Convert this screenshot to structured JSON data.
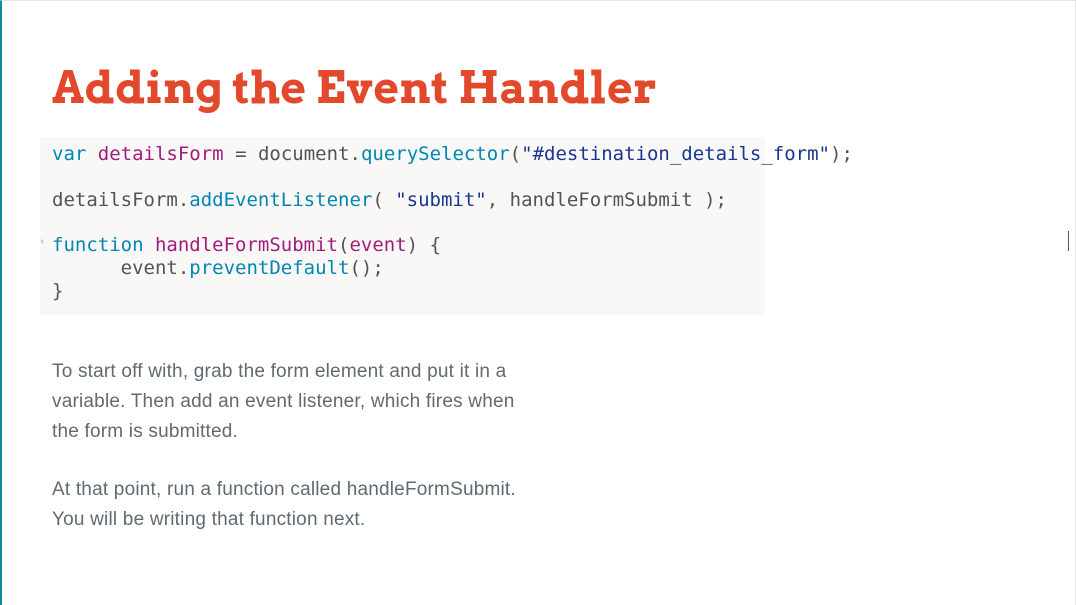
{
  "title": "Adding the Event Handler",
  "code": {
    "l1": {
      "kw": "var",
      "sp1": " ",
      "id": "detailsForm",
      "sp2": " ",
      "eq": "=",
      "sp3": " ",
      "doc": "document",
      "dot1": ".",
      "m1": "querySelector",
      "op": "(",
      "str": "\"#destination_details_form\"",
      "cp": ")",
      "semi": ";"
    },
    "l2_blank": "",
    "l3": {
      "id": "detailsForm",
      "dot": ".",
      "m": "addEventListener",
      "op": "( ",
      "str": "\"submit\"",
      "comma": ", ",
      "fn": "handleFormSubmit",
      "cp": " )",
      "semi": ";"
    },
    "l4_blank": "",
    "l5": {
      "kw": "function",
      "sp": " ",
      "fn": "handleFormSubmit",
      "op": "(",
      "arg": "event",
      "cp": ")",
      "sp2": " ",
      "brace": "{"
    },
    "l6": {
      "indent": "      ",
      "obj": "event",
      "dot": ".",
      "m": "preventDefault",
      "parens": "()",
      "semi": ";"
    },
    "l7": {
      "brace": "}"
    },
    "tick": "'"
  },
  "prose": {
    "p1": "To start off with, grab the form element and put it in a variable. Then add an event listener, which fires when the form is submitted.",
    "p2": "At that point, run a function called handleFormSubmit. You will be writing that function next."
  }
}
